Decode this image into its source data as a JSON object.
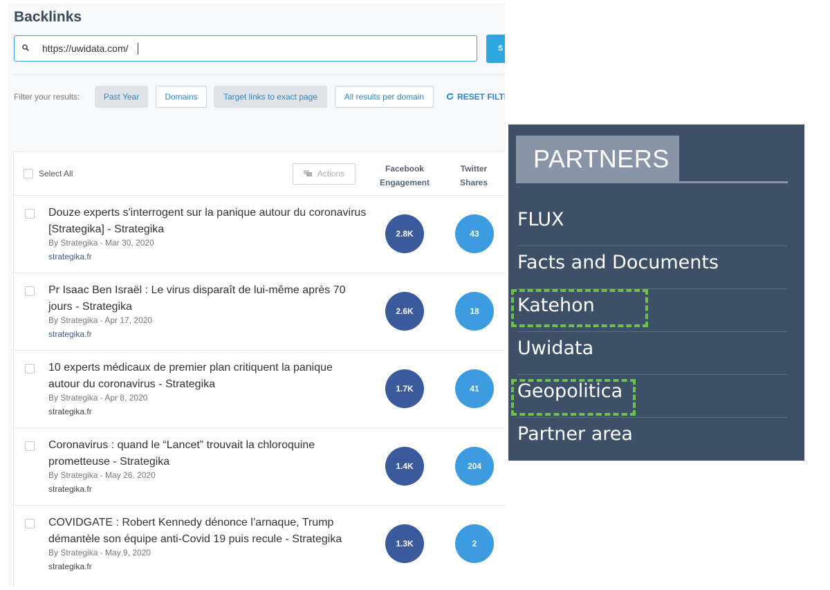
{
  "backlinks": {
    "title": "Backlinks",
    "search": {
      "value": "https://uwidata.com/",
      "button_label": "S"
    },
    "filters": {
      "label": "Filter your results:",
      "buttons": [
        "Past Year",
        "Domains",
        "Target links to exact page",
        "All results per domain"
      ],
      "reset_label": "RESET FILTE"
    },
    "table": {
      "select_all_label": "Select All",
      "actions_label": "Actions",
      "columns": [
        {
          "line1": "Facebook",
          "line2": "Engagement"
        },
        {
          "line1": "Twitter",
          "line2": "Shares"
        }
      ],
      "rows": [
        {
          "title": "Douze experts s'interrogent sur la panique autour du coronavirus [Strategika] - Strategika",
          "meta": "By Strategika - Mar 30, 2020",
          "domain": "strategika.fr",
          "facebook": "2.8K",
          "twitter": "43"
        },
        {
          "title": "Pr Isaac Ben Israël : Le virus disparaît de lui-même après 70 jours - Strategika",
          "meta": "By Strategika - Apr 17, 2020",
          "domain": "strategika.fr",
          "facebook": "2.6K",
          "twitter": "18"
        },
        {
          "title": "10 experts médicaux de premier plan critiquent la panique autour du coronavirus - Strategika",
          "meta": "By Strategika - Apr 8, 2020",
          "domain": "strategika.fr",
          "facebook": "1.7K",
          "twitter": "41"
        },
        {
          "title": "Coronavirus : quand le “Lancet” trouvait la chloroquine prometteuse - Strategika",
          "meta": "By Strategika - May 26, 2020",
          "domain": "strategika.fr",
          "facebook": "1.4K",
          "twitter": "204"
        },
        {
          "title": "COVIDGATE : Robert Kennedy dénonce l’arnaque, Trump démantèle son équipe anti-Covid 19 puis recule - Strategika",
          "meta": "By Strategika - May 9, 2020",
          "domain": "strategika.fr",
          "facebook": "1.3K",
          "twitter": "2"
        }
      ]
    }
  },
  "partners": {
    "title": "PARTNERS",
    "items": [
      "FLUX",
      "Facts and Documents",
      "Katehon",
      "Uwidata",
      "Geopolitica",
      "Partner area"
    ],
    "highlighted_items": [
      "Katehon",
      "Geopolitica"
    ],
    "highlight_color": "#6cc24a"
  },
  "colors": {
    "accent_blue": "#2ea6df",
    "facebook_circle": "#3a5a9c",
    "twitter_circle": "#3d9be0",
    "partners_bg": "#3e5068"
  }
}
